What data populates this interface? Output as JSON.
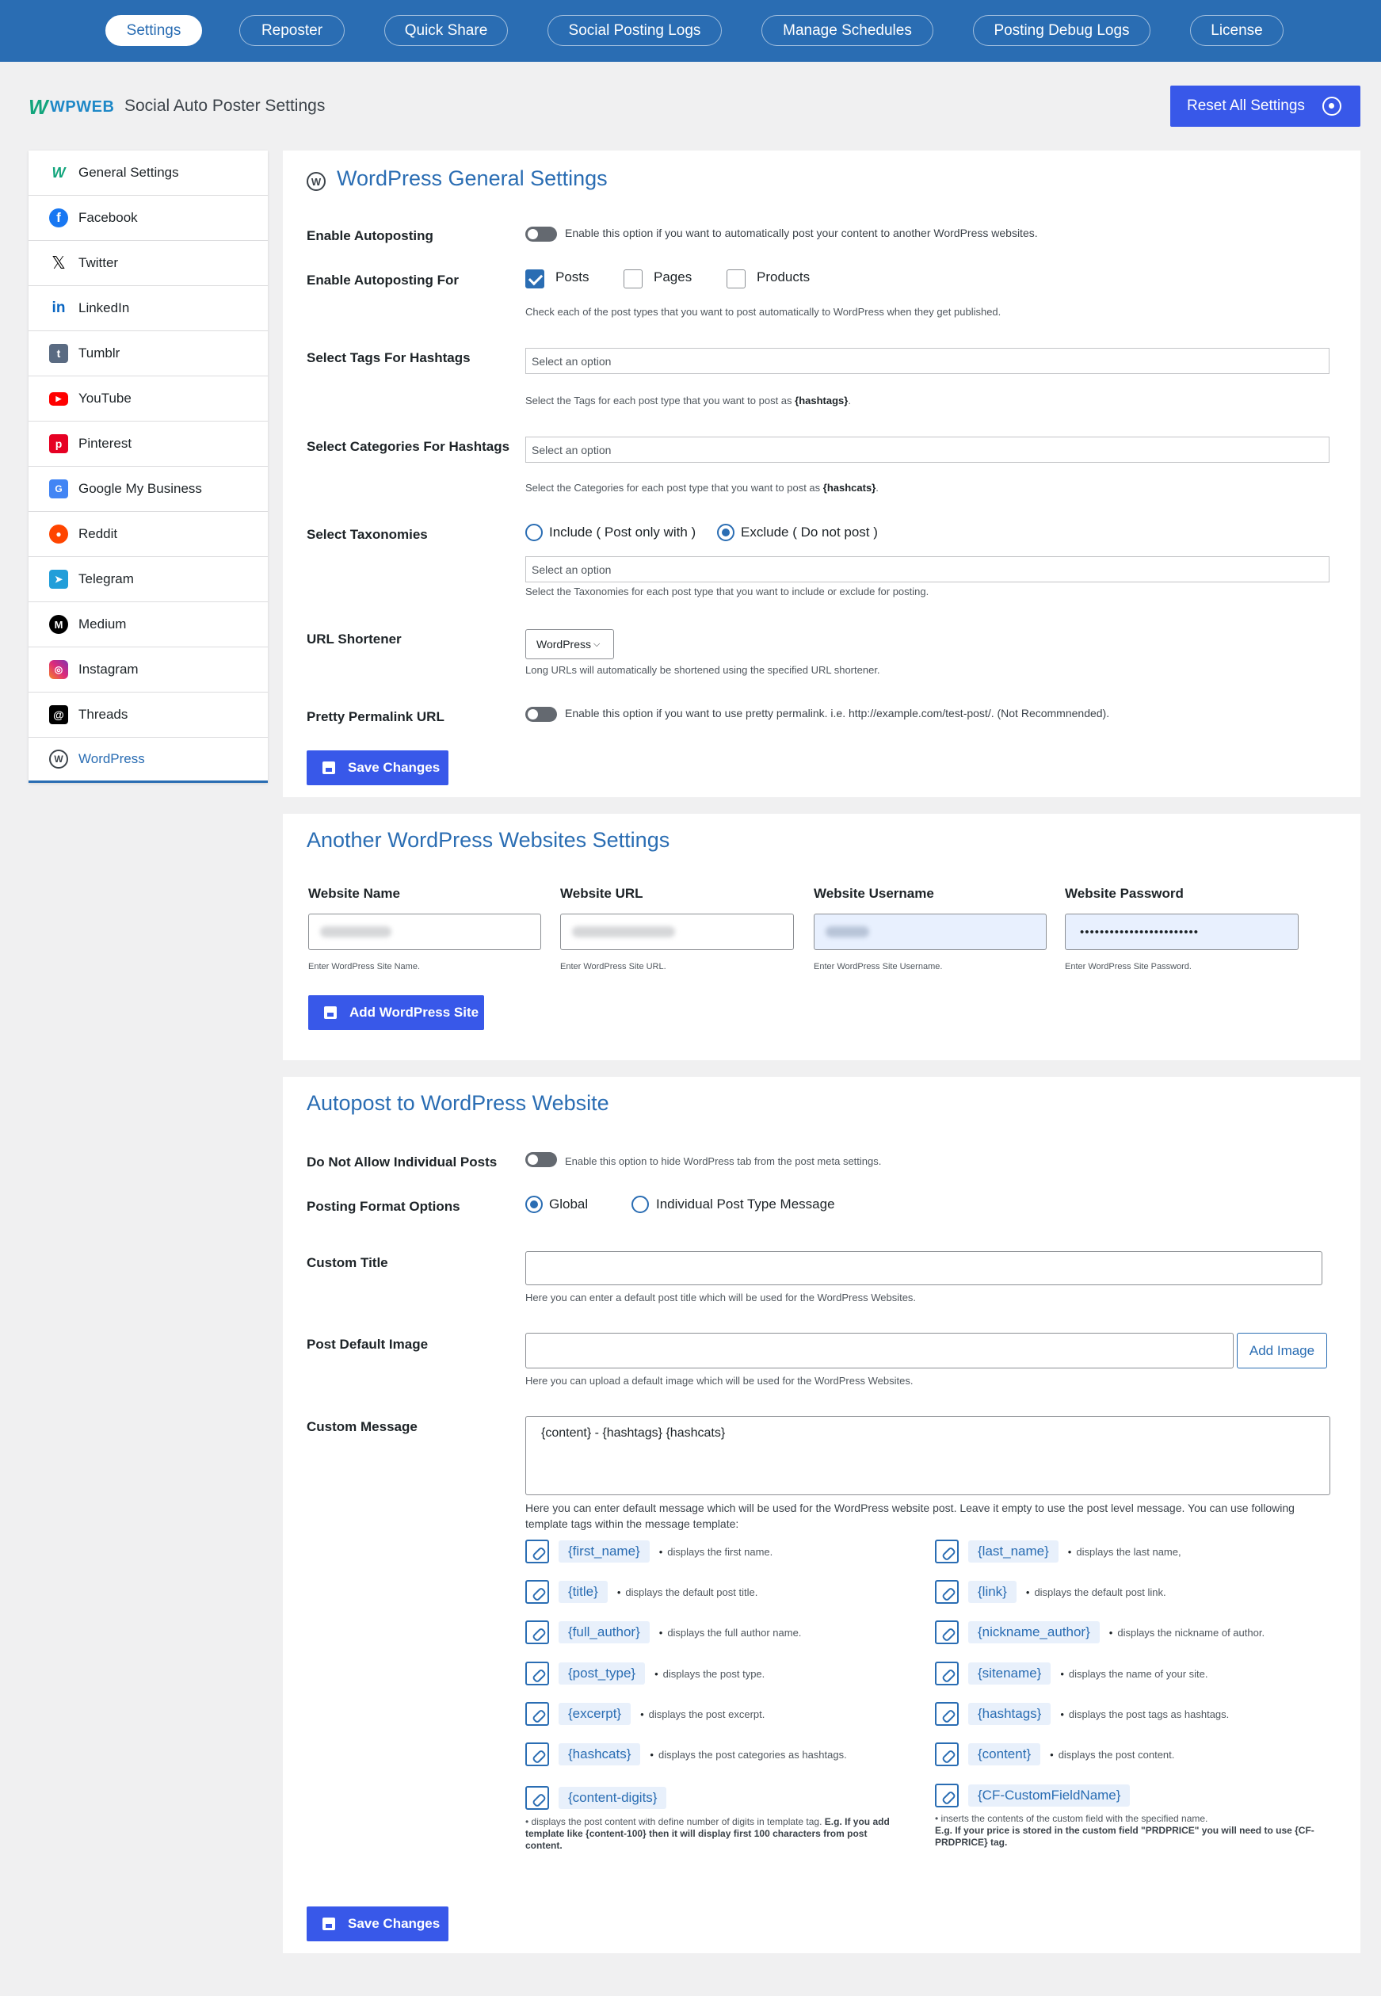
{
  "nav": {
    "tabs": [
      "Settings",
      "Reposter",
      "Quick Share",
      "Social Posting Logs",
      "Manage Schedules",
      "Posting Debug Logs",
      "License"
    ]
  },
  "header": {
    "brand": "WPWEB",
    "title": "Social Auto Poster Settings",
    "reset_label": "Reset All Settings"
  },
  "sidebar": {
    "items": [
      "General Settings",
      "Facebook",
      "Twitter",
      "LinkedIn",
      "Tumblr",
      "YouTube",
      "Pinterest",
      "Google My Business",
      "Reddit",
      "Telegram",
      "Medium",
      "Instagram",
      "Threads",
      "WordPress"
    ]
  },
  "general": {
    "title": "WordPress General Settings",
    "enable_autoposting_label": "Enable Autoposting",
    "enable_autoposting_desc": "Enable this option if you want to automatically post your content to another WordPress websites.",
    "autoposting_for_label": "Enable Autoposting For",
    "posts": "Posts",
    "pages": "Pages",
    "products": "Products",
    "autoposting_for_desc": "Check each of the post types that you want to post automatically to WordPress when they get published.",
    "tags_label": "Select Tags For Hashtags",
    "select_placeholder": "Select an option",
    "tags_desc_pre": "Select the Tags for each post type that you want to post as ",
    "tags_desc_tag": "{hashtags}",
    "categories_label": "Select Categories For Hashtags",
    "categories_desc_pre": "Select the Categories for each post type that you want to post as ",
    "categories_desc_tag": "{hashcats}",
    "taxonomies_label": "Select Taxonomies",
    "include_label": "Include ( Post only with )",
    "exclude_label": "Exclude ( Do not post )",
    "taxonomies_desc": "Select the Taxonomies for each post type that you want to include or exclude for posting.",
    "url_shortener_label": "URL Shortener",
    "url_shortener_value": "WordPress",
    "url_shortener_desc": "Long URLs will automatically be shortened using the specified URL shortener.",
    "permalink_label": "Pretty Permalink URL",
    "permalink_desc": "Enable this option if you want to use pretty permalink. i.e. http://example.com/test-post/. (Not Recommnended).",
    "save_label": "Save Changes"
  },
  "sites": {
    "title": "Another WordPress Websites Settings",
    "col_name": "Website Name",
    "col_url": "Website URL",
    "col_user": "Website Username",
    "col_pass": "Website Password",
    "password_value": "••••••••••••••••••••••••",
    "hint_name": "Enter WordPress Site Name.",
    "hint_url": "Enter WordPress Site URL.",
    "hint_user": "Enter WordPress Site Username.",
    "hint_pass": "Enter WordPress Site Password.",
    "add_label": "Add WordPress Site"
  },
  "autopost": {
    "title": "Autopost to WordPress Website",
    "individual_label": "Do Not Allow Individual Posts",
    "individual_desc": "Enable this option to hide WordPress tab from the post meta settings.",
    "format_label": "Posting Format Options",
    "global_label": "Global",
    "individual_type_label": "Individual Post Type Message",
    "custom_title_label": "Custom Title",
    "custom_title_desc": "Here you can enter a default post title which will be used for the WordPress Websites.",
    "default_image_label": "Post Default Image",
    "add_image_label": "Add Image",
    "default_image_desc": "Here you can upload a default image which will be used for the WordPress Websites.",
    "custom_message_label": "Custom Message",
    "custom_message_value": "{content} - {hashtags} {hashcats}",
    "custom_message_desc": "Here you can enter default message which will be used for the WordPress website post. Leave it empty to use the post level message. You can use following template tags within the message template:",
    "tags_left": [
      {
        "tag": "{first_name}",
        "desc": "displays the first name."
      },
      {
        "tag": "{title}",
        "desc": "displays the default post title."
      },
      {
        "tag": "{full_author}",
        "desc": "displays the full author name."
      },
      {
        "tag": "{post_type}",
        "desc": "displays the post type."
      },
      {
        "tag": "{excerpt}",
        "desc": "displays the post excerpt."
      },
      {
        "tag": "{hashcats}",
        "desc": "displays the post categories as hashtags."
      }
    ],
    "tags_right": [
      {
        "tag": "{last_name}",
        "desc": "displays the last name,"
      },
      {
        "tag": "{link}",
        "desc": "displays the default post link."
      },
      {
        "tag": "{nickname_author}",
        "desc": "displays the nickname of author."
      },
      {
        "tag": "{sitename}",
        "desc": "displays the name of your site."
      },
      {
        "tag": "{hashtags}",
        "desc": "displays the post tags as hashtags."
      },
      {
        "tag": "{content}",
        "desc": "displays the post content."
      }
    ],
    "content_digits_tag": "{content-digits}",
    "content_digits_desc": "displays the post content with define number of digits in template tag.",
    "content_digits_example": "E.g. If you add template like {content-100} then it will display first 100 characters from post content.",
    "cf_tag": "{CF-CustomFieldName}",
    "cf_desc": "inserts the contents of the custom field with the specified name.",
    "cf_example": "E.g. If your price is stored in the custom field \"PRDPRICE\" you will need to use {CF-PRDPRICE} tag.",
    "save_label": "Save Changes"
  }
}
